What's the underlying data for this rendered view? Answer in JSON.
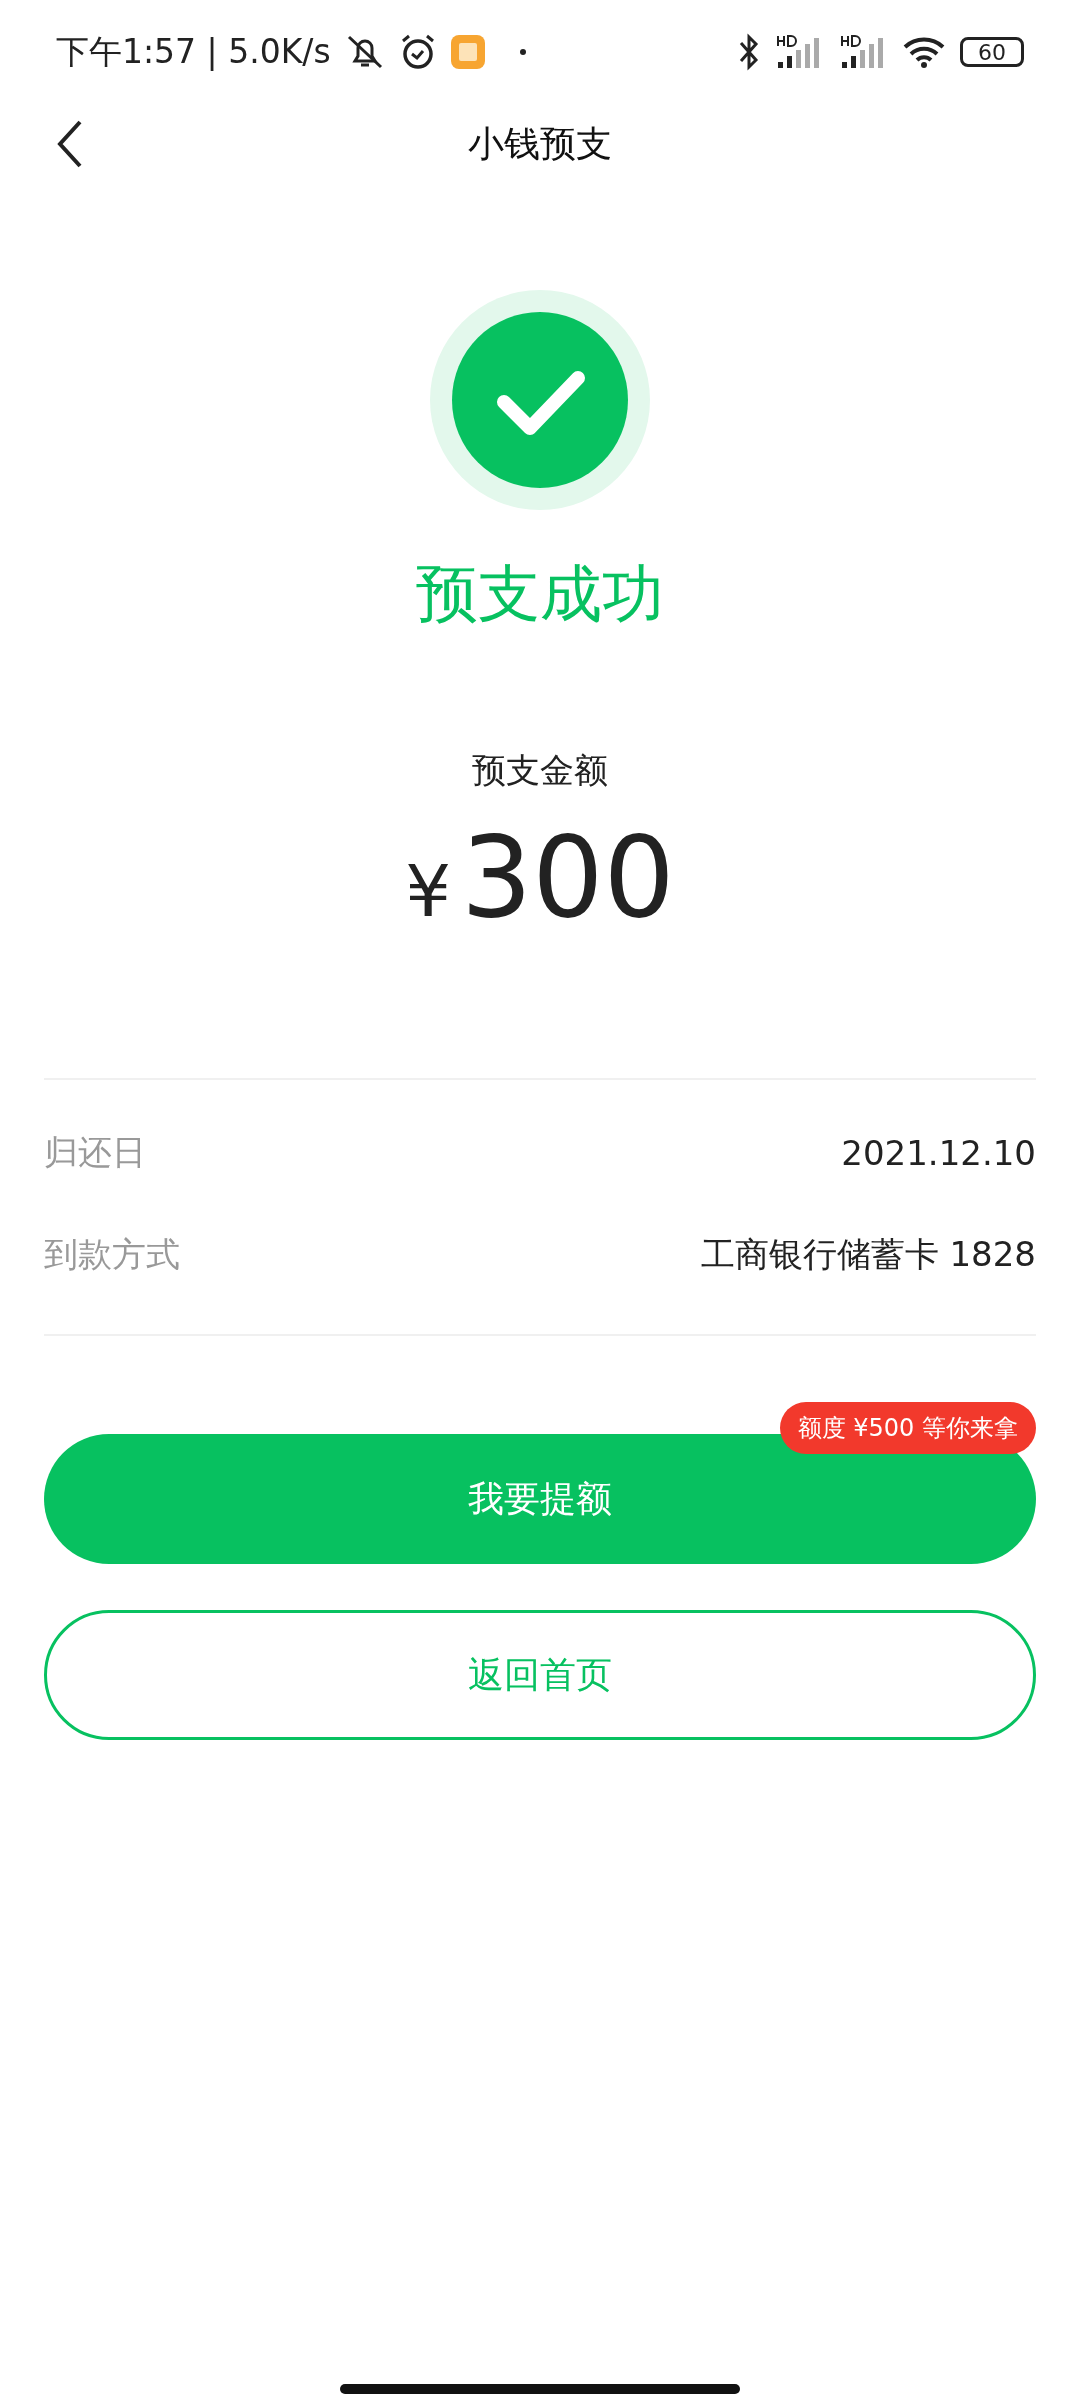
{
  "status_bar": {
    "time": "下午1:57 | 5.0K/s",
    "battery": "60"
  },
  "nav": {
    "title": "小钱预支"
  },
  "result": {
    "title": "预支成功",
    "amount_label": "预支金额",
    "currency": "¥",
    "amount": "300"
  },
  "details": [
    {
      "label": "归还日",
      "value": "2021.12.10"
    },
    {
      "label": "到款方式",
      "value": "工商银行储蓄卡 1828"
    }
  ],
  "badge": "额度 ¥500 等你来拿",
  "buttons": [
    {
      "kind": "primary",
      "label": "我要提额"
    },
    {
      "kind": "outline",
      "label": "返回首页"
    }
  ]
}
